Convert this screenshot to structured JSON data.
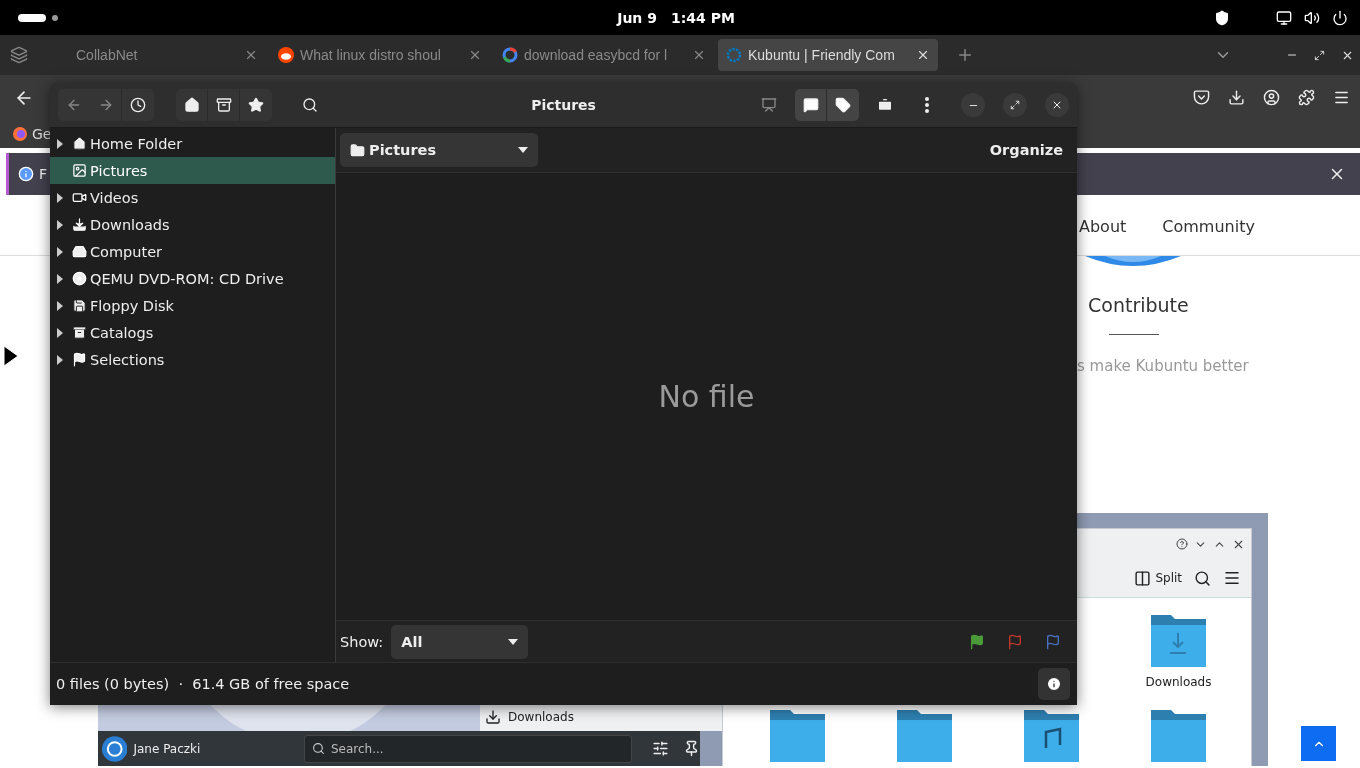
{
  "top_panel": {
    "date": "Jun 9",
    "time": "1:44 PM"
  },
  "browser": {
    "tabs": [
      {
        "title": "CollabNet",
        "selected": false
      },
      {
        "title": "What linux distro shoul",
        "selected": false
      },
      {
        "title": "download easybcd for l",
        "selected": false
      },
      {
        "title": "Kubuntu | Friendly Com",
        "selected": true
      }
    ],
    "bookmark": "Ge",
    "notification": "F",
    "page": {
      "nav": [
        "About",
        "Community"
      ],
      "heading": "Contribute",
      "tagline": "s make Kubuntu better",
      "screenshot": {
        "user": "Jane Paczki",
        "search_placeholder": "Search...",
        "menu_item": "Downloads",
        "split": "Split",
        "folder": "Downloads"
      }
    }
  },
  "file_manager": {
    "title": "Pictures",
    "sidebar": [
      {
        "label": "Home Folder",
        "expandable": true,
        "selected": false
      },
      {
        "label": "Pictures",
        "expandable": false,
        "selected": true
      },
      {
        "label": "Videos",
        "expandable": true,
        "selected": false
      },
      {
        "label": "Downloads",
        "expandable": true,
        "selected": false
      },
      {
        "label": "Computer",
        "expandable": true,
        "selected": false
      },
      {
        "label": "QEMU DVD-ROM: CD Drive",
        "expandable": true,
        "selected": false
      },
      {
        "label": "Floppy Disk",
        "expandable": true,
        "selected": false
      },
      {
        "label": "Catalogs",
        "expandable": true,
        "selected": false
      },
      {
        "label": "Selections",
        "expandable": true,
        "selected": false
      }
    ],
    "location": "Pictures",
    "organize": "Organize",
    "empty_text": "No file",
    "show_label": "Show:",
    "show_value": "All",
    "status": "0 files (0 bytes)  ·  61.4 GB of free space"
  }
}
